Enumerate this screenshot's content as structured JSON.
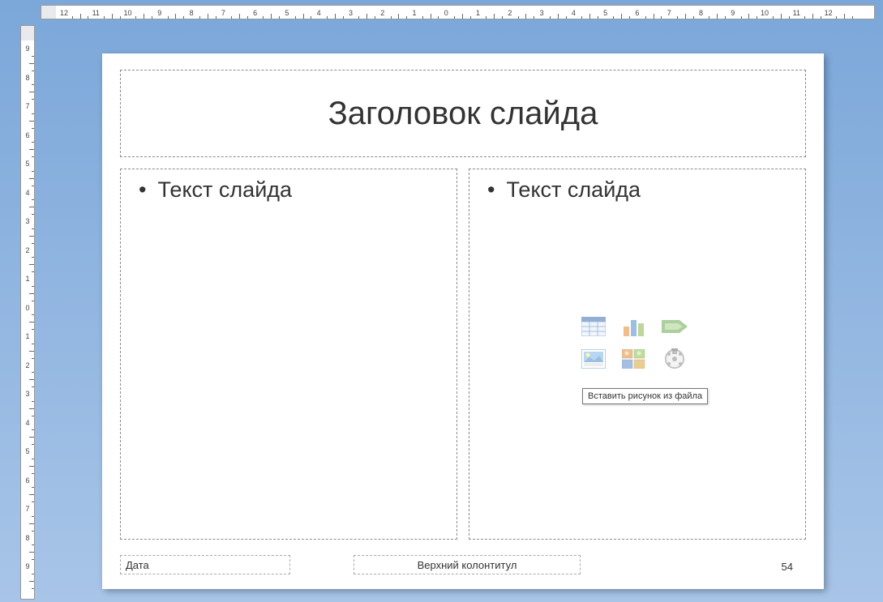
{
  "ruler": {
    "horizontal": [
      "12",
      "11",
      "10",
      "9",
      "8",
      "7",
      "6",
      "5",
      "4",
      "3",
      "2",
      "1",
      "0",
      "1",
      "2",
      "3",
      "4",
      "5",
      "6",
      "7",
      "8",
      "9",
      "10",
      "11",
      "12"
    ],
    "vertical": [
      "9",
      "8",
      "7",
      "6",
      "5",
      "4",
      "3",
      "2",
      "1",
      "0",
      "1",
      "2",
      "3",
      "4",
      "5",
      "6",
      "7",
      "8",
      "9"
    ]
  },
  "slide": {
    "title_text": "Заголовок слайда",
    "left_content_text": "Текст слайда",
    "right_content_text": "Текст слайда",
    "footer": {
      "date": "Дата",
      "header": "Верхний колонтитул",
      "page_number": "54"
    }
  },
  "content_icons": {
    "table": "table-icon",
    "chart": "chart-icon",
    "smartart": "smartart-icon",
    "picture": "picture-icon",
    "clipart": "clipart-icon",
    "media": "media-icon"
  },
  "tooltip": {
    "text": "Вставить рисунок из файла"
  }
}
